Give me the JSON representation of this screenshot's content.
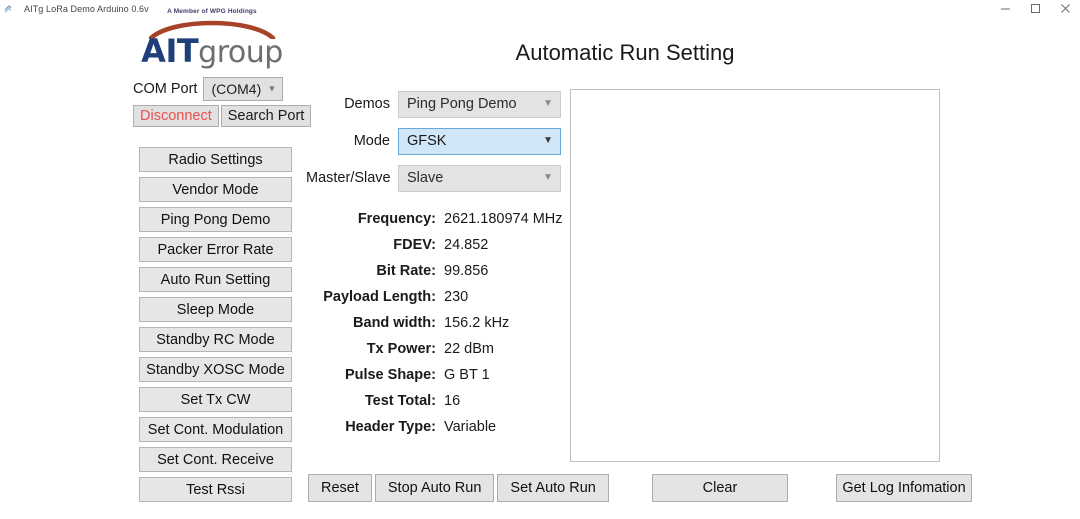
{
  "window": {
    "title": "AITg LoRa Demo Arduino 0.6v",
    "app_icon": "app-icon",
    "minimize_label": "—",
    "maximize_label": "❐",
    "close_label": "✕"
  },
  "brand": {
    "member_line": "A Member of WPG Holdings",
    "name_bold": "AIT",
    "name_rest": "group",
    "arc_color": "#a8432a",
    "bold_color": "#1f3f7a",
    "rest_color": "#6d6e71"
  },
  "connection": {
    "com_port_label": "COM Port",
    "com_port_value": "(COM4)",
    "disconnect_label": "Disconnect",
    "disconnect_color": "#e8504f",
    "search_port_label": "Search Port"
  },
  "sidebar": {
    "items": [
      {
        "label": "Radio Settings"
      },
      {
        "label": "Vendor Mode"
      },
      {
        "label": "Ping Pong Demo"
      },
      {
        "label": "Packer Error Rate"
      },
      {
        "label": "Auto Run Setting"
      },
      {
        "label": "Sleep Mode"
      },
      {
        "label": "Standby RC Mode"
      },
      {
        "label": "Standby XOSC Mode"
      },
      {
        "label": "Set Tx CW"
      },
      {
        "label": "Set Cont. Modulation"
      },
      {
        "label": "Set Cont. Receive"
      },
      {
        "label": "Test Rssi"
      }
    ]
  },
  "main": {
    "title": "Automatic Run Setting",
    "selectors": [
      {
        "label": "Demos",
        "value": "Ping Pong Demo",
        "focused": false
      },
      {
        "label": "Mode",
        "value": "GFSK",
        "focused": true
      },
      {
        "label": "Master/Slave",
        "value": "Slave",
        "focused": false
      }
    ],
    "parameters": [
      {
        "key": "Frequency:",
        "value": "2621.180974 MHz"
      },
      {
        "key": "FDEV:",
        "value": "24.852"
      },
      {
        "key": "Bit Rate:",
        "value": "99.856"
      },
      {
        "key": "Payload Length:",
        "value": "230"
      },
      {
        "key": "Band width:",
        "value": "156.2 kHz"
      },
      {
        "key": "Tx Power:",
        "value": "22 dBm"
      },
      {
        "key": "Pulse Shape:",
        "value": "G BT 1"
      },
      {
        "key": "Test Total:",
        "value": "16"
      },
      {
        "key": "Header Type:",
        "value": "Variable"
      }
    ],
    "log_text": ""
  },
  "actions": {
    "reset_label": "Reset",
    "stop_auto_run_label": "Stop Auto Run",
    "set_auto_run_label": "Set Auto Run",
    "clear_label": "Clear",
    "get_log_label": "Get Log Infomation"
  },
  "colors": {
    "accent_blue": "#cfe7f9",
    "accent_border": "#6ba8d6",
    "button_face": "#e4e4e4",
    "panel_border": "#bfbfbf"
  }
}
